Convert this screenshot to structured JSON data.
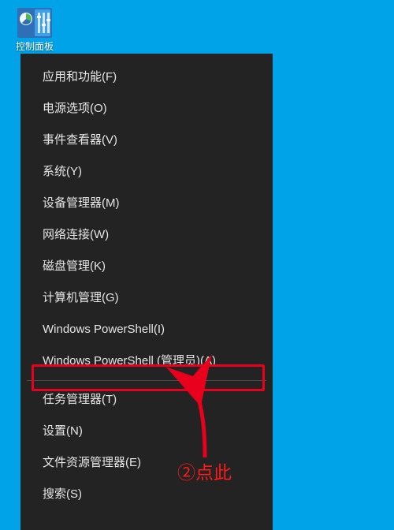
{
  "desktop": {
    "icon_label": "控制面板"
  },
  "menu": {
    "items": [
      "应用和功能(F)",
      "电源选项(O)",
      "事件查看器(V)",
      "系统(Y)",
      "设备管理器(M)",
      "网络连接(W)",
      "磁盘管理(K)",
      "计算机管理(G)",
      "Windows PowerShell(I)",
      "Windows PowerShell (管理员)(A)",
      "任务管理器(T)",
      "设置(N)",
      "文件资源管理器(E)",
      "搜索(S)"
    ]
  },
  "annotation_text": "②点此"
}
